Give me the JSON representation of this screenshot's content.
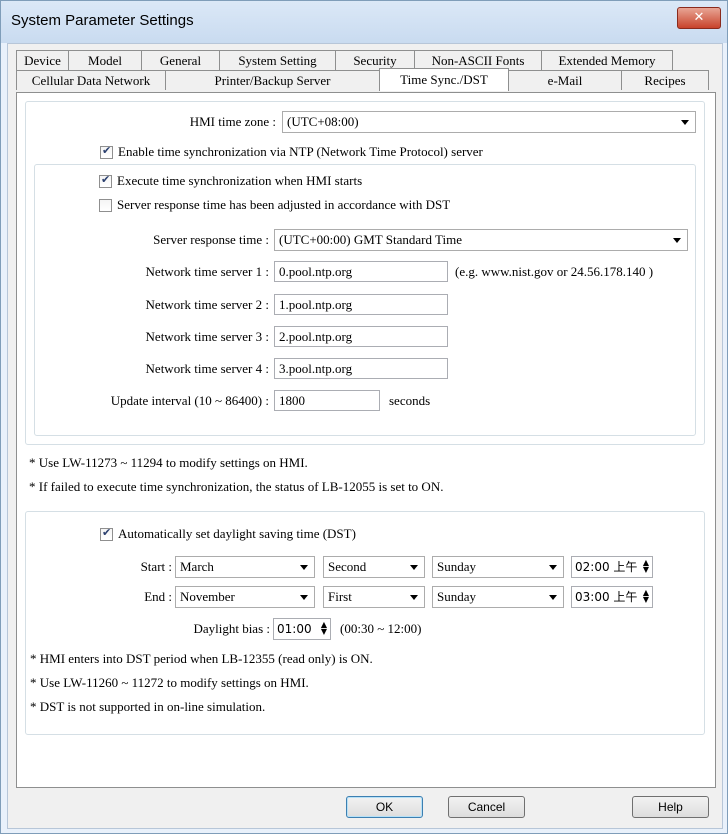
{
  "window": {
    "title": "System Parameter Settings",
    "close_label": "✕"
  },
  "tabs_row1": [
    "Device",
    "Model",
    "General",
    "System Setting",
    "Security",
    "Non-ASCII Fonts",
    "Extended Memory"
  ],
  "tabs_row2": [
    "Cellular Data Network",
    "Printer/Backup Server",
    "Time Sync./DST",
    "e-Mail",
    "Recipes"
  ],
  "active_tab": "Time Sync./DST",
  "timezone": {
    "label": "HMI time zone :",
    "value": "(UTC+08:00)"
  },
  "ntp": {
    "enable_label": "Enable time synchronization via NTP (Network Time Protocol) server",
    "enable_checked": true,
    "execute_label": "Execute time synchronization when HMI starts",
    "execute_checked": true,
    "dst_adjust_label": "Server response time has been adjusted in accordance with DST",
    "dst_adjust_checked": false,
    "response_label": "Server response time :",
    "response_value": "(UTC+00:00) GMT Standard Time",
    "servers": [
      {
        "label": "Network time server 1 :",
        "value": "0.pool.ntp.org"
      },
      {
        "label": "Network time server 2 :",
        "value": "1.pool.ntp.org"
      },
      {
        "label": "Network time server 3 :",
        "value": "2.pool.ntp.org"
      },
      {
        "label": "Network time server 4 :",
        "value": "3.pool.ntp.org"
      }
    ],
    "server_example": "(e.g. www.nist.gov or 24.56.178.140 )",
    "interval_label": "Update interval (10 ~ 86400) :",
    "interval_value": "1800",
    "interval_unit": "seconds"
  },
  "notes1": [
    "* Use LW-11273 ~ 11294 to modify settings on HMI.",
    "* If failed to execute time synchronization, the status of LB-12055 is set to ON."
  ],
  "dst": {
    "auto_label": "Automatically set daylight saving time (DST)",
    "auto_checked": true,
    "start_label": "Start :",
    "start": {
      "month": "March",
      "week": "Second",
      "day": "Sunday",
      "time": "02:00 上午"
    },
    "end_label": "End :",
    "end": {
      "month": "November",
      "week": "First",
      "day": "Sunday",
      "time": "03:00 上午"
    },
    "bias_label": "Daylight bias :",
    "bias_value": "01:00",
    "bias_range": "(00:30 ~ 12:00)"
  },
  "notes2": [
    "* HMI enters into DST period when LB-12355 (read only) is ON.",
    "* Use LW-11260 ~ 11272 to modify settings on HMI.",
    "* DST is not supported in on-line simulation."
  ],
  "buttons": {
    "ok": "OK",
    "cancel": "Cancel",
    "help": "Help"
  }
}
